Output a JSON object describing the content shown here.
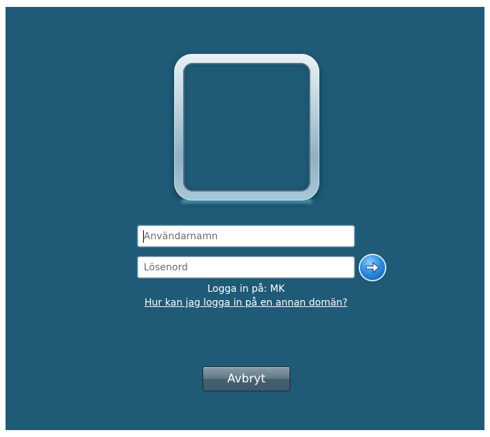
{
  "login": {
    "username_placeholder": "Användarnamn",
    "password_placeholder": "Lösenord",
    "logon_to": "Logga in på: MK",
    "other_domain_link": "Hur kan jag logga in på en annan domän?",
    "cancel_label": "Avbryt"
  },
  "icons": {
    "user_tile": "user-picture-frame",
    "submit": "arrow-right-circle-icon"
  },
  "colors": {
    "background": "#1f5a77",
    "text": "#ffffff"
  }
}
